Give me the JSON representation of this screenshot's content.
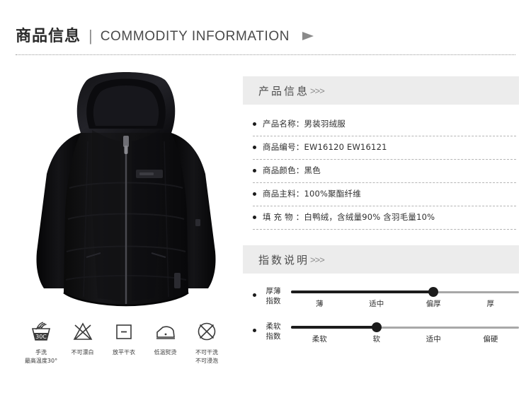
{
  "header": {
    "title_cn": "商品信息",
    "separator": "|",
    "title_en": "COMMODITY INFORMATION",
    "arrow_icon": "play-triangle-icon"
  },
  "product_image": {
    "alt": "男装羽绒服",
    "color": "#0c0c0c"
  },
  "care_instructions": [
    {
      "icon": "hand-wash-icon",
      "temp": "30",
      "label": "手洗\n最高温度30°"
    },
    {
      "icon": "no-bleach-icon",
      "label": "不可漂白"
    },
    {
      "icon": "dry-flat-icon",
      "label": "放平干衣"
    },
    {
      "icon": "low-temp-iron-icon",
      "label": "低温熨烫"
    },
    {
      "icon": "no-dry-clean-icon",
      "label": "不可干洗\n不可浸泡"
    }
  ],
  "product_info": {
    "section_title": "产品信息",
    "section_arrows": ">>>",
    "rows": [
      {
        "label": "产品名称：",
        "value": "男装羽绒服"
      },
      {
        "label": "商品编号：",
        "value": "EW16120  EW16121"
      },
      {
        "label": "商品颜色：",
        "value": "黑色"
      },
      {
        "label": "商品主料：",
        "value": "100%聚酯纤维"
      },
      {
        "label": "填 充 物 ：",
        "value": "白鸭绒，含绒量90% 含羽毛量10%"
      }
    ]
  },
  "index_info": {
    "section_title": "指数说明",
    "section_arrows": ">>>",
    "sliders": [
      {
        "name": "厚薄\n指数",
        "ticks": [
          "薄",
          "适中",
          "偏厚",
          "厚"
        ],
        "selected_index": 2,
        "selected_label": "偏厚"
      },
      {
        "name": "柔软\n指数",
        "ticks": [
          "柔软",
          "软",
          "适中",
          "偏硬"
        ],
        "selected_index": 1,
        "selected_label": "软"
      }
    ]
  },
  "colors": {
    "section_bar_bg": "#ececec",
    "track_active": "#1c1c1c",
    "track_inactive": "#a8a8a8",
    "text": "#2f2f2f"
  }
}
